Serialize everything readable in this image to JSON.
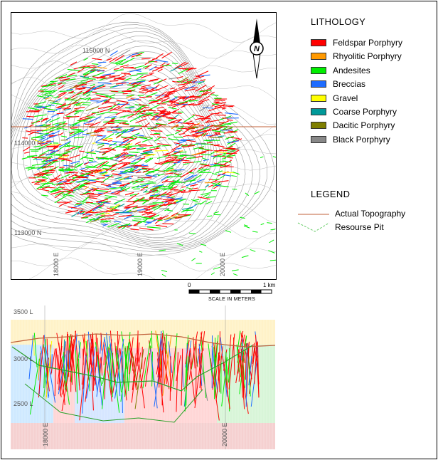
{
  "plan_view": {
    "coords_north": [
      "115000 N",
      "114000 N",
      "113000 N"
    ],
    "coords_east": [
      "18000 E",
      "19000 E",
      "20000 E"
    ],
    "north_symbol": "N"
  },
  "scale_bar": {
    "start": "0",
    "end": "1 km",
    "caption": "SCALE IN METERS"
  },
  "section_view": {
    "elevations": [
      "3500 L",
      "3000 L",
      "2500 L"
    ],
    "coords_east": [
      "18000 E",
      "20000 E"
    ]
  },
  "lithology": {
    "title": "LITHOLOGY",
    "items": [
      {
        "label": "Feldspar Porphyry",
        "color": "#ff0000"
      },
      {
        "label": "Rhyolitic Porphyry",
        "color": "#ff9900"
      },
      {
        "label": "Andesites",
        "color": "#00ee00"
      },
      {
        "label": "Breccias",
        "color": "#1e6cff"
      },
      {
        "label": "Gravel",
        "color": "#ffff00"
      },
      {
        "label": "Coarse Porphyry",
        "color": "#009999"
      },
      {
        "label": "Dacitic Porphyry",
        "color": "#7f7f00"
      },
      {
        "label": "Black Porphyry",
        "color": "#888888"
      }
    ]
  },
  "legend": {
    "title": "LEGEND",
    "items": [
      {
        "label": "Actual Topography",
        "color": "#c0603a",
        "icon": "solid-line-icon"
      },
      {
        "label": "Resourse Pit",
        "color": "#66cc66",
        "icon": "dashed-outline-icon"
      }
    ]
  }
}
